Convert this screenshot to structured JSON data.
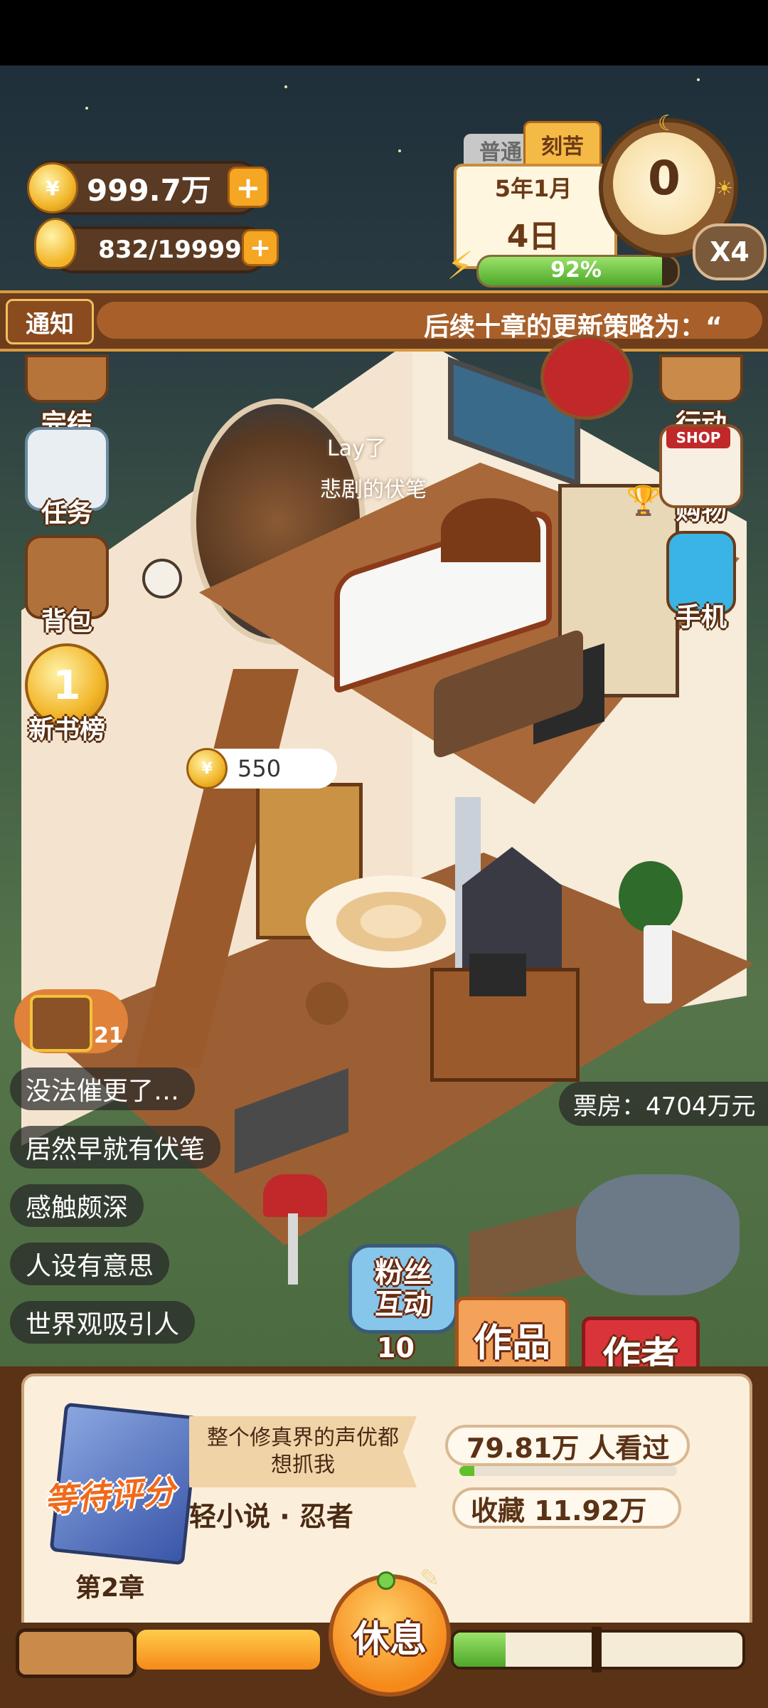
{
  "currency": {
    "gold": "999.7万",
    "gold_plus": "+",
    "coin_symbol": "¥",
    "energy": "832/19999",
    "energy_plus": "+"
  },
  "date_panel": {
    "tab_normal": "普通",
    "tab_hard": "刻苦",
    "year_month": "5年1月",
    "day": "4日",
    "progress_label": "92%",
    "progress_fraction": 0.92
  },
  "timer": {
    "value": "0",
    "speed": "X4"
  },
  "notice": {
    "tag": "通知",
    "text": "后续十章的更新策略为：“"
  },
  "side_menu_left": [
    {
      "label": "完结",
      "icon": "book-stack-icon"
    },
    {
      "label": "任务",
      "icon": "checklist-icon"
    },
    {
      "label": "背包",
      "icon": "backpack-icon"
    },
    {
      "label": "新书榜",
      "icon": "gold-medal-icon",
      "badge": "1"
    }
  ],
  "side_menu_right": [
    {
      "label": "行动",
      "icon": "door-icon"
    },
    {
      "label": "购物",
      "icon": "shop-icon",
      "sign": "SHOP"
    },
    {
      "label": "手机",
      "icon": "phone-icon"
    }
  ],
  "floating_text": {
    "line1": "Lay了",
    "line2": "悲剧的伏笔"
  },
  "coin_bubble": {
    "value": "550"
  },
  "chest": {
    "count": "21"
  },
  "comments": [
    "没法催更了…",
    "居然早就有伏笔",
    "感触颇深",
    "人设有意思",
    "世界观吸引人"
  ],
  "box_office": "票房：4704万元",
  "fan_interaction": {
    "label": "粉丝互动",
    "count": "10"
  },
  "tabs": {
    "works": "作品",
    "author": "作者"
  },
  "book": {
    "title": "整个修真界的声优都想抓我",
    "status_stamp": "等待评分",
    "genre": "轻小说 · 忍者",
    "chapter": "第2章",
    "views": "79.81万 人看过",
    "views_fraction": 0.07,
    "favorites": "收藏 11.92万"
  },
  "rest_button": "休息",
  "bottom_bars": {
    "left_fraction": 1.0,
    "middle_fraction": 1.0,
    "right_fraction": 0.18
  },
  "colors": {
    "accent": "#f5a623",
    "brown": "#5a3216",
    "green": "#5fc02b"
  }
}
